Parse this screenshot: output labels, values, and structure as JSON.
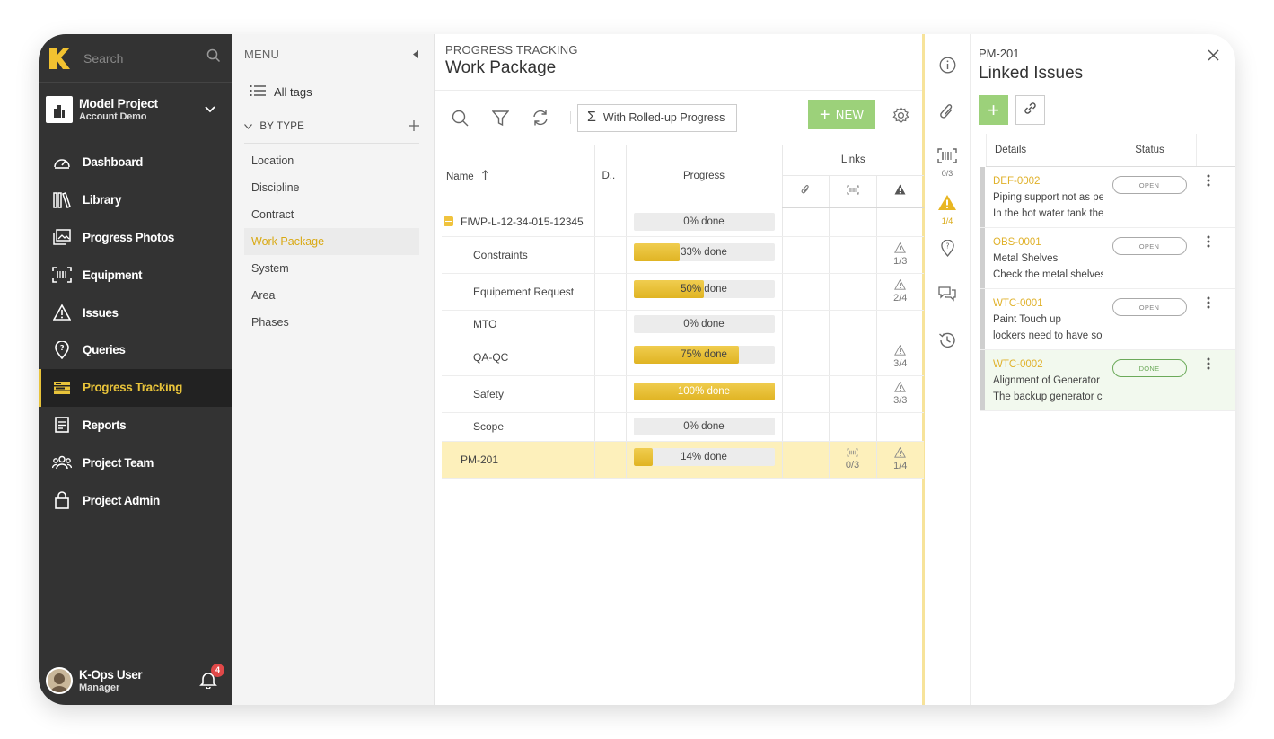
{
  "nav": {
    "search_placeholder": "Search",
    "project": {
      "name": "Model Project",
      "account": "Account Demo"
    },
    "items": [
      {
        "label": "Dashboard",
        "icon": "dashboard-gauge-icon"
      },
      {
        "label": "Library",
        "icon": "library-books-icon"
      },
      {
        "label": "Progress Photos",
        "icon": "photos-icon"
      },
      {
        "label": "Equipment",
        "icon": "barcode-scan-icon"
      },
      {
        "label": "Issues",
        "icon": "warning-triangle-icon"
      },
      {
        "label": "Queries",
        "icon": "map-pin-question-icon"
      },
      {
        "label": "Progress Tracking",
        "icon": "progress-bars-icon",
        "active": true
      },
      {
        "label": "Reports",
        "icon": "report-document-icon"
      },
      {
        "label": "Project Team",
        "icon": "team-people-icon"
      },
      {
        "label": "Project Admin",
        "icon": "lock-icon"
      }
    ],
    "user": {
      "name": "K-Ops User",
      "role": "Manager",
      "notifications": "4"
    },
    "accent": "#e8c33a"
  },
  "menu": {
    "title": "MENU",
    "all_tags": "All tags",
    "by_type": "BY TYPE",
    "items": [
      "Location",
      "Discipline",
      "Contract",
      "Work Package",
      "System",
      "Area",
      "Phases"
    ],
    "active": "Work Package"
  },
  "main": {
    "breadcrumb": "PROGRESS TRACKING",
    "title": "Work Package",
    "rolled_up": "With Rolled-up Progress",
    "new_label": "NEW",
    "columns": {
      "name": "Name",
      "d": "D..",
      "progress": "Progress",
      "links": "Links"
    },
    "rows": [
      {
        "name": "FIWP-L-12-34-015-12345",
        "progress": 0,
        "progress_label": "0% done",
        "level": 0,
        "parent": true,
        "attach": "",
        "equip": "",
        "issues": ""
      },
      {
        "name": "Constraints",
        "progress": 33,
        "progress_label": "33% done",
        "level": 1,
        "attach": "",
        "equip": "",
        "issues": "1/3"
      },
      {
        "name": "Equipement Request",
        "progress": 50,
        "progress_label": "50% done",
        "level": 1,
        "attach": "",
        "equip": "",
        "issues": "2/4"
      },
      {
        "name": "MTO",
        "progress": 0,
        "progress_label": "0% done",
        "level": 1,
        "attach": "",
        "equip": "",
        "issues": ""
      },
      {
        "name": "QA-QC",
        "progress": 75,
        "progress_label": "75% done",
        "level": 1,
        "attach": "",
        "equip": "",
        "issues": "3/4"
      },
      {
        "name": "Safety",
        "progress": 100,
        "progress_label": "100% done",
        "level": 1,
        "attach": "",
        "equip": "",
        "issues": "3/3"
      },
      {
        "name": "Scope",
        "progress": 0,
        "progress_label": "0% done",
        "level": 1,
        "attach": "",
        "equip": "",
        "issues": ""
      },
      {
        "name": "PM-201",
        "progress": 14,
        "progress_label": "14% done",
        "level": 0,
        "selected": true,
        "attach": "",
        "equip": "0/3",
        "issues": "1/4"
      }
    ]
  },
  "rail": {
    "equipment_count": "0/3",
    "issues_count": "1/4"
  },
  "linked": {
    "id": "PM-201",
    "title": "Linked Issues",
    "columns": {
      "details": "Details",
      "status": "Status"
    },
    "issues": [
      {
        "code": "DEF-0002",
        "line1": "Piping support not as per",
        "line2": "In the hot water tank the",
        "status": "OPEN"
      },
      {
        "code": "OBS-0001",
        "line1": "Metal Shelves",
        "line2": "Check the metal shelves",
        "status": "OPEN"
      },
      {
        "code": "WTC-0001",
        "line1": "Paint Touch up",
        "line2": "lockers need to have som",
        "status": "OPEN"
      },
      {
        "code": "WTC-0002",
        "line1": "Alignment of Generator r",
        "line2": "The backup generator co",
        "status": "DONE"
      }
    ]
  }
}
